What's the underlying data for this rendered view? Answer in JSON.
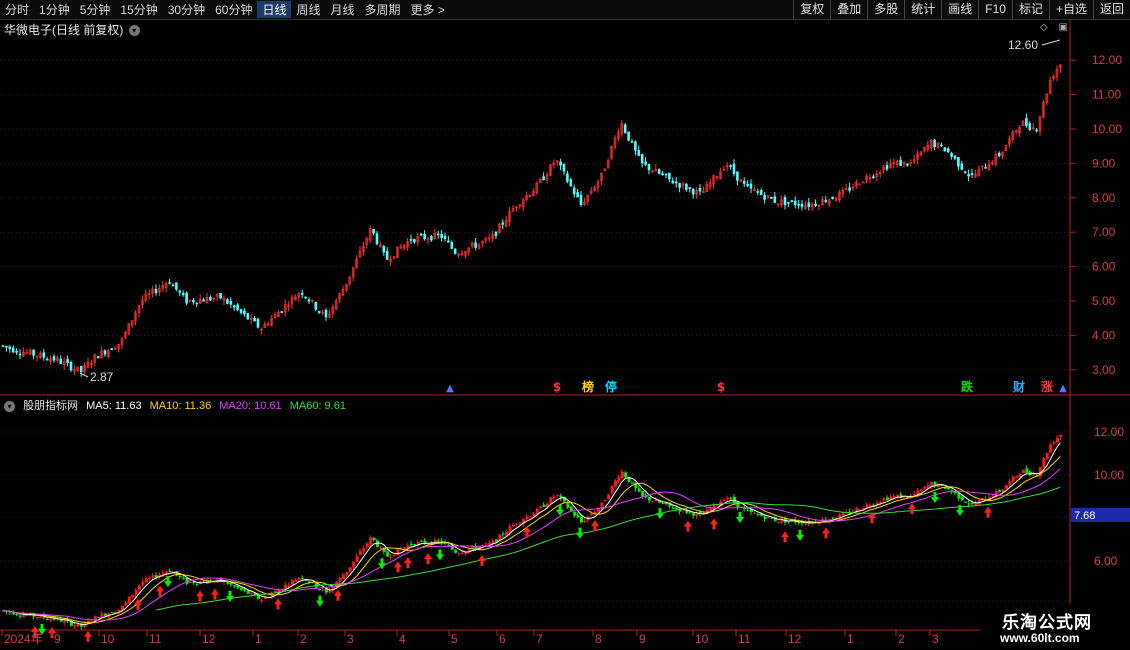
{
  "toolbar": {
    "periods": [
      "分时",
      "1分钟",
      "5分钟",
      "15分钟",
      "30分钟",
      "60分钟",
      "日线",
      "周线",
      "月线",
      "多周期",
      "更多 >"
    ],
    "active_period": "日线",
    "actions": [
      "复权",
      "叠加",
      "多股",
      "统计",
      "画线",
      "F10",
      "标记",
      "+自选",
      "返回"
    ]
  },
  "stock_title": "华微电子(日线 前复权)",
  "main_chart": {
    "y_ticks": [
      "12.00",
      "11.00",
      "10.00",
      "9.00",
      "8.00",
      "7.00",
      "6.00",
      "5.00",
      "4.00",
      "3.00"
    ],
    "high_label": "12.60",
    "low_label": "2.87",
    "markers": [
      {
        "text": "$",
        "color": "#ff3b3b"
      },
      {
        "text": "榜",
        "color": "#ffd000"
      },
      {
        "text": "停",
        "color": "#00d8ff"
      },
      {
        "text": "$",
        "color": "#ff3b3b"
      },
      {
        "text": "跌",
        "color": "#00e000"
      },
      {
        "text": "财",
        "color": "#33aaff"
      },
      {
        "text": "涨",
        "color": "#ff3b3b"
      }
    ]
  },
  "indicator": {
    "name": "股朋指标网",
    "ma5": "MA5: 11.63",
    "ma10": "MA10: 11.36",
    "ma20": "MA20: 10.61",
    "ma60": "MA60: 9.61",
    "y_ticks": [
      "12.00",
      "10.00",
      "6.00"
    ],
    "current": "7.68"
  },
  "x_axis": [
    "2024年",
    "9",
    "10",
    "11",
    "12",
    "1",
    "2",
    "3",
    "4",
    "5",
    "6",
    "7",
    "8",
    "9",
    "10",
    "11",
    "12",
    "1",
    "2",
    "3"
  ],
  "watermark": {
    "name": "乐淘公式网",
    "url": "www.60lt.com"
  }
}
